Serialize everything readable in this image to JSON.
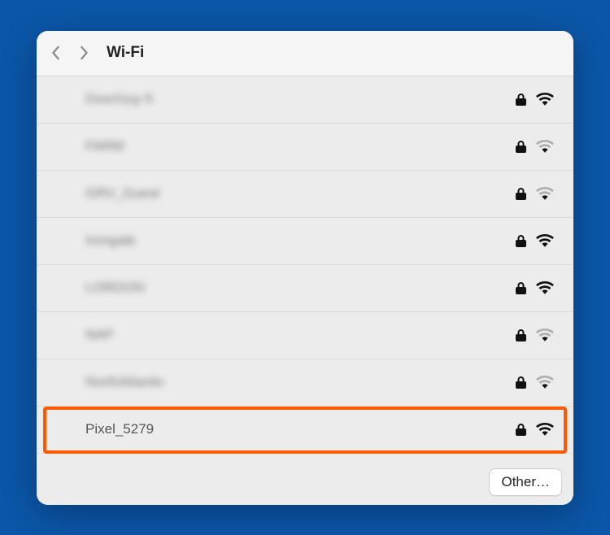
{
  "header": {
    "title": "Wi-Fi"
  },
  "networks": [
    {
      "ssid": "DoorGuy-5",
      "locked": true,
      "signal": "strong",
      "blurred": true
    },
    {
      "ssid": "FARM",
      "locked": true,
      "signal": "weak",
      "blurred": true
    },
    {
      "ssid": "GRV_Guest",
      "locked": true,
      "signal": "weak",
      "blurred": true
    },
    {
      "ssid": "Irongate",
      "locked": true,
      "signal": "strong",
      "blurred": true
    },
    {
      "ssid": "LORDON",
      "locked": true,
      "signal": "strong",
      "blurred": true
    },
    {
      "ssid": "NAP",
      "locked": true,
      "signal": "weak",
      "blurred": true
    },
    {
      "ssid": "NorthAtlantic",
      "locked": true,
      "signal": "weak",
      "blurred": true
    },
    {
      "ssid": "Pixel_5279",
      "locked": true,
      "signal": "strong",
      "blurred": false,
      "highlighted": true
    }
  ],
  "footer": {
    "other_label": "Other…"
  }
}
